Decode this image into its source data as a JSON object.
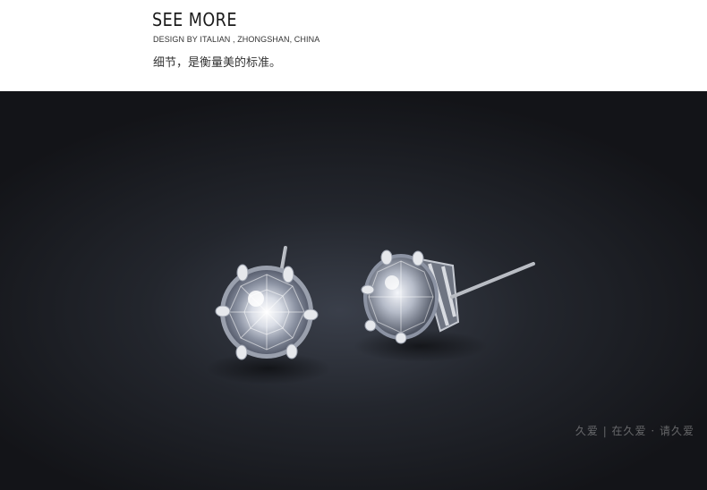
{
  "header": {
    "title": "SEE MORE",
    "subtitle": "DESIGN BY ITALIAN , ZHONGSHAN, CHINA",
    "tagline": "细节，是衡量美的标准。"
  },
  "photo": {
    "subject": "earring",
    "watermark": "久爱 | 在久爱 · 请久爱"
  },
  "colors": {
    "background_dark": "#1b1d22",
    "header_bg": "#ffffff",
    "text_dark": "#1a1a1a"
  }
}
